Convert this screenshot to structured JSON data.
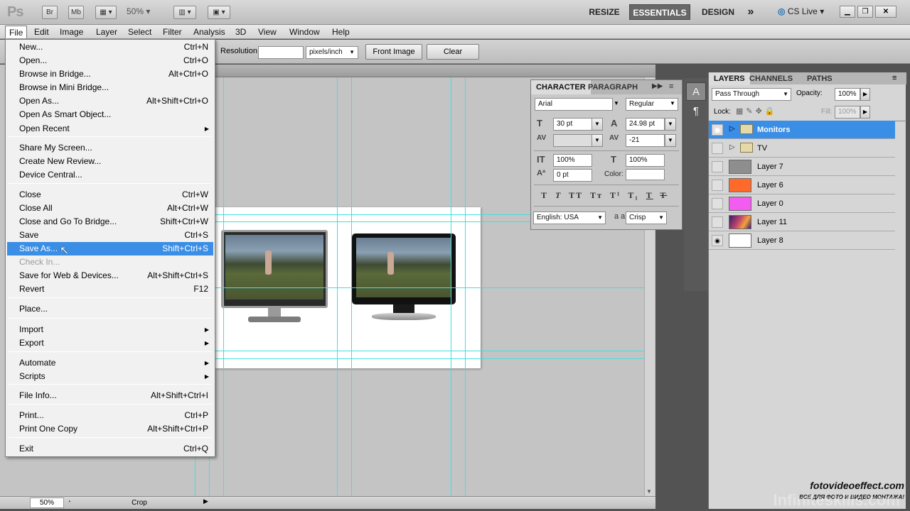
{
  "app": {
    "logo": "Ps",
    "br_label": "Br",
    "mb_label": "Mb",
    "zoom": "50%"
  },
  "workspaces": {
    "resize": "RESIZE",
    "essentials": "ESSENTIALS",
    "design": "DESIGN",
    "more": "»",
    "cslive": "CS Live"
  },
  "menubar": [
    "File",
    "Edit",
    "Image",
    "Layer",
    "Select",
    "Filter",
    "Analysis",
    "3D",
    "View",
    "Window",
    "Help"
  ],
  "options": {
    "resolution_label": "Resolution:",
    "resolution_value": "",
    "units": "pixels/inch",
    "front_image": "Front Image",
    "clear": "Clear"
  },
  "file_menu": [
    {
      "label": "New...",
      "shortcut": "Ctrl+N"
    },
    {
      "label": "Open...",
      "shortcut": "Ctrl+O"
    },
    {
      "label": "Browse in Bridge...",
      "shortcut": "Alt+Ctrl+O"
    },
    {
      "label": "Browse in Mini Bridge...",
      "shortcut": ""
    },
    {
      "label": "Open As...",
      "shortcut": "Alt+Shift+Ctrl+O"
    },
    {
      "label": "Open As Smart Object...",
      "shortcut": ""
    },
    {
      "label": "Open Recent",
      "shortcut": "",
      "submenu": true
    },
    {
      "label": "Share My Screen...",
      "shortcut": ""
    },
    {
      "label": "Create New Review...",
      "shortcut": ""
    },
    {
      "label": "Device Central...",
      "shortcut": ""
    },
    {
      "label": "Close",
      "shortcut": "Ctrl+W"
    },
    {
      "label": "Close All",
      "shortcut": "Alt+Ctrl+W"
    },
    {
      "label": "Close and Go To Bridge...",
      "shortcut": "Shift+Ctrl+W"
    },
    {
      "label": "Save",
      "shortcut": "Ctrl+S"
    },
    {
      "label": "Save As...",
      "shortcut": "Shift+Ctrl+S",
      "selected": true
    },
    {
      "label": "Check In...",
      "shortcut": "",
      "disabled": true
    },
    {
      "label": "Save for Web & Devices...",
      "shortcut": "Alt+Shift+Ctrl+S"
    },
    {
      "label": "Revert",
      "shortcut": "F12"
    },
    {
      "label": "Place...",
      "shortcut": ""
    },
    {
      "label": "Import",
      "shortcut": "",
      "submenu": true
    },
    {
      "label": "Export",
      "shortcut": "",
      "submenu": true
    },
    {
      "label": "Automate",
      "shortcut": "",
      "submenu": true
    },
    {
      "label": "Scripts",
      "shortcut": "",
      "submenu": true
    },
    {
      "label": "File Info...",
      "shortcut": "Alt+Shift+Ctrl+I"
    },
    {
      "label": "Print...",
      "shortcut": "Ctrl+P"
    },
    {
      "label": "Print One Copy",
      "shortcut": "Alt+Shift+Ctrl+P"
    },
    {
      "label": "Exit",
      "shortcut": "Ctrl+Q"
    }
  ],
  "character": {
    "tab_character": "CHARACTER",
    "tab_paragraph": "PARAGRAPH",
    "font": "Arial",
    "style": "Regular",
    "size": "30 pt",
    "leading": "24.98 pt",
    "kerning": "",
    "tracking": "-21",
    "vscale": "100%",
    "hscale": "100%",
    "baseline": "0 pt",
    "color_label": "Color:",
    "language": "English: USA",
    "aa_icon": "a a",
    "antialias": "Crisp"
  },
  "layers_panel": {
    "tabs": [
      "LAYERS",
      "CHANNELS",
      "PATHS"
    ],
    "blend": "Pass Through",
    "opacity_label": "Opacity:",
    "opacity": "100%",
    "lock_label": "Lock:",
    "fill_label": "Fill:",
    "fill": "100%",
    "layers": [
      {
        "name": "Monitors",
        "type": "group",
        "selected": true,
        "visible": true
      },
      {
        "name": "TV",
        "type": "group",
        "visible": false
      },
      {
        "name": "Layer 7",
        "color": "#8e8e8e",
        "visible": false
      },
      {
        "name": "Layer 6",
        "color": "#ff6a2a",
        "visible": false
      },
      {
        "name": "Layer 0",
        "color": "#f25cf0",
        "visible": false
      },
      {
        "name": "Layer 11",
        "color": "gradient",
        "visible": false
      },
      {
        "name": "Layer 8",
        "color": "#ffffff",
        "visible": true
      }
    ]
  },
  "status": {
    "zoom": "50%",
    "tool": "Crop"
  },
  "watermark": {
    "line1": "fotovideoeffect.com",
    "line2": "ВСЕ ДЛЯ ФОТО И ВИДЕО МОНТАЖА!",
    "line3": "Infiniteskills.com"
  }
}
